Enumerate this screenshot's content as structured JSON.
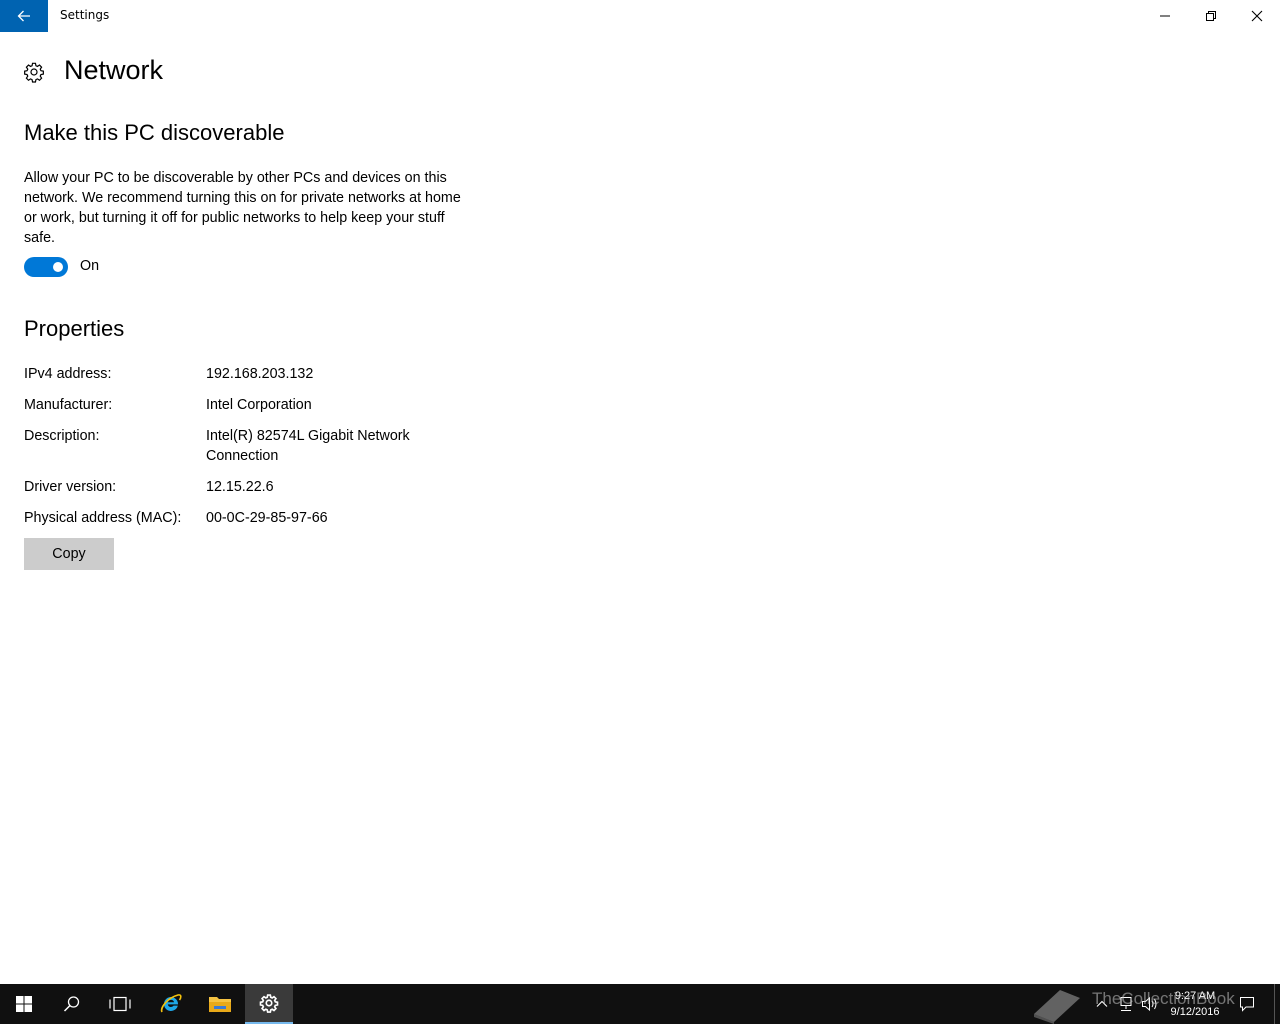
{
  "window": {
    "title": "Settings"
  },
  "header": {
    "title": "Network"
  },
  "discoverable": {
    "title": "Make this PC discoverable",
    "description": "Allow your PC to be discoverable by other PCs and devices on this network. We recommend turning this on for private networks at home or work, but turning it off for public networks to help keep your stuff safe.",
    "toggle_state": "On",
    "toggle_on": true
  },
  "properties": {
    "title": "Properties",
    "rows": [
      {
        "label": "IPv4 address:",
        "value": "192.168.203.132"
      },
      {
        "label": "Manufacturer:",
        "value": "Intel Corporation"
      },
      {
        "label": "Description:",
        "value": "Intel(R) 82574L Gigabit Network Connection"
      },
      {
        "label": "Driver version:",
        "value": "12.15.22.6"
      },
      {
        "label": "Physical address (MAC):",
        "value": "00-0C-29-85-97-66"
      }
    ],
    "copy_label": "Copy"
  },
  "taskbar": {
    "time": "9:27 AM",
    "date": "9/12/2016",
    "watermark": "TheCollectionBook"
  },
  "colors": {
    "accent": "#0078d7",
    "back_button": "#0063b1",
    "taskbar": "#101010"
  }
}
